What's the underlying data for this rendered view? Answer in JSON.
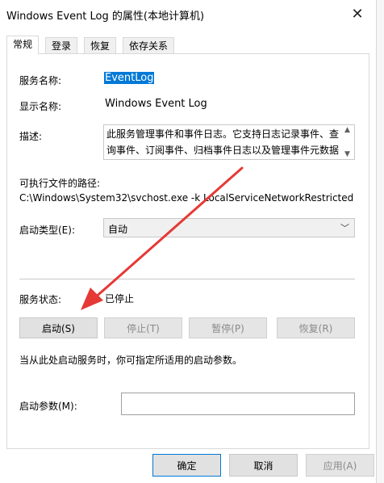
{
  "window": {
    "title": "Windows Event Log 的属性(本地计算机)",
    "close_label": "✕"
  },
  "tabs": [
    {
      "label": "常规",
      "active": true
    },
    {
      "label": "登录",
      "active": false
    },
    {
      "label": "恢复",
      "active": false
    },
    {
      "label": "依存关系",
      "active": false
    }
  ],
  "general": {
    "service_name_label": "服务名称:",
    "service_name_value": "EventLog",
    "display_name_label": "显示名称:",
    "display_name_value": "Windows Event Log",
    "description_label": "描述:",
    "description_value": "此服务管理事件和事件日志。它支持日志记录事件、查询事件、订阅事件、归档事件日志以及管理事件元数据",
    "exec_path_label": "可执行文件的路径:",
    "exec_path_value": "C:\\Windows\\System32\\svchost.exe -k LocalServiceNetworkRestricted",
    "startup_type_label": "启动类型(E):",
    "startup_type_value": "自动",
    "service_status_label": "服务状态:",
    "service_status_value": "已停止",
    "buttons": {
      "start": "启动(S)",
      "stop": "停止(T)",
      "pause": "暂停(P)",
      "resume": "恢复(R)"
    },
    "hint_text": "当从此处启动服务时，你可指定所适用的启动参数。",
    "start_params_label": "启动参数(M):",
    "start_params_value": ""
  },
  "footer": {
    "ok_label": "确定",
    "cancel_label": "取消",
    "apply_label": "应用(A)"
  },
  "colors": {
    "accent": "#0078d7",
    "annotation_arrow": "#e53935"
  }
}
